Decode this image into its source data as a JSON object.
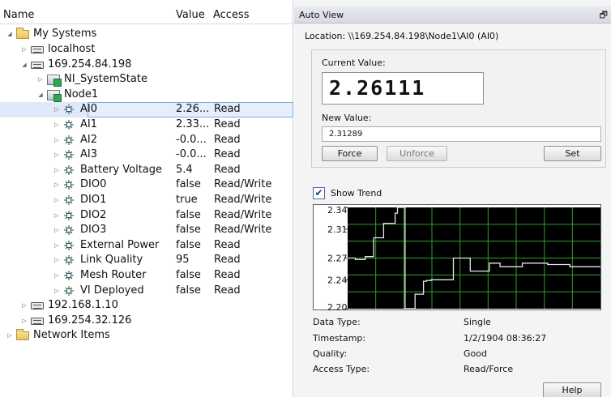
{
  "tree": {
    "columns": {
      "name": "Name",
      "value": "Value",
      "access": "Access"
    },
    "rows": [
      {
        "label": "My Systems",
        "icon": "folder-icon",
        "level": 0,
        "twisty": "open"
      },
      {
        "label": "localhost",
        "icon": "target-icon",
        "level": 1,
        "twisty": "closed"
      },
      {
        "label": "169.254.84.198",
        "icon": "target-icon",
        "level": 1,
        "twisty": "open"
      },
      {
        "label": "NI_SystemState",
        "icon": "node-icon",
        "level": 2,
        "twisty": "closed"
      },
      {
        "label": "Node1",
        "icon": "node-icon",
        "level": 2,
        "twisty": "open"
      },
      {
        "label": "AI0",
        "icon": "channel-icon",
        "level": 3,
        "twisty": "closed",
        "value": "2.26...",
        "access": "Read",
        "selected": true
      },
      {
        "label": "AI1",
        "icon": "channel-icon",
        "level": 3,
        "twisty": "closed",
        "value": "2.33...",
        "access": "Read"
      },
      {
        "label": "AI2",
        "icon": "channel-icon",
        "level": 3,
        "twisty": "closed",
        "value": "-0.0...",
        "access": "Read"
      },
      {
        "label": "AI3",
        "icon": "channel-icon",
        "level": 3,
        "twisty": "closed",
        "value": "-0.0...",
        "access": "Read"
      },
      {
        "label": "Battery Voltage",
        "icon": "channel-icon",
        "level": 3,
        "twisty": "closed",
        "value": "5.4",
        "access": "Read"
      },
      {
        "label": "DIO0",
        "icon": "channel-icon",
        "level": 3,
        "twisty": "closed",
        "value": "false",
        "access": "Read/Write"
      },
      {
        "label": "DIO1",
        "icon": "channel-icon",
        "level": 3,
        "twisty": "closed",
        "value": "true",
        "access": "Read/Write"
      },
      {
        "label": "DIO2",
        "icon": "channel-icon",
        "level": 3,
        "twisty": "closed",
        "value": "false",
        "access": "Read/Write"
      },
      {
        "label": "DIO3",
        "icon": "channel-icon",
        "level": 3,
        "twisty": "closed",
        "value": "false",
        "access": "Read/Write"
      },
      {
        "label": "External Power",
        "icon": "channel-icon",
        "level": 3,
        "twisty": "closed",
        "value": "false",
        "access": "Read"
      },
      {
        "label": "Link Quality",
        "icon": "channel-icon",
        "level": 3,
        "twisty": "closed",
        "value": "95",
        "access": "Read"
      },
      {
        "label": "Mesh Router",
        "icon": "channel-icon",
        "level": 3,
        "twisty": "closed",
        "value": "false",
        "access": "Read"
      },
      {
        "label": "VI Deployed",
        "icon": "channel-icon",
        "level": 3,
        "twisty": "closed",
        "value": "false",
        "access": "Read"
      },
      {
        "label": "192.168.1.10",
        "icon": "target-icon",
        "level": 1,
        "twisty": "closed"
      },
      {
        "label": "169.254.32.126",
        "icon": "target-icon",
        "level": 1,
        "twisty": "closed"
      },
      {
        "label": "Network Items",
        "icon": "folder-icon",
        "level": 0,
        "twisty": "closed"
      }
    ]
  },
  "panel": {
    "title": "Auto View",
    "restore_icon": "restore-window-icon",
    "location": "Location: \\\\169.254.84.198\\Node1\\AI0 (AI0)",
    "current_value_label": "Current Value:",
    "current_value": "2.26111",
    "new_value_label": "New Value:",
    "new_value": "2.31289",
    "force_label": "Force",
    "unforce_label": "Unforce",
    "set_label": "Set",
    "show_trend_label": "Show Trend",
    "show_trend_checked": true,
    "info": [
      {
        "label": "Data Type:",
        "value": "Single"
      },
      {
        "label": "Timestamp:",
        "value": "1/2/1904 08:36:27"
      },
      {
        "label": "Quality:",
        "value": "Good"
      },
      {
        "label": "Access Type:",
        "value": "Read/Force"
      }
    ],
    "help_label": "Help"
  },
  "chart_data": {
    "type": "line",
    "y_ticks": [
      "2.34",
      "2.31",
      "2.27",
      "2.24",
      "2.20"
    ],
    "ylim": [
      2.2,
      2.34
    ],
    "grid": true,
    "colors": {
      "background": "#000000",
      "grid": "#2f9e2f",
      "line": "#e6e6e6",
      "tick_label": "#111111"
    },
    "x": [
      0,
      10,
      10,
      23,
      23,
      34,
      34,
      47,
      47,
      62,
      62,
      65,
      65,
      75,
      75,
      88,
      88,
      99,
      99,
      103,
      103,
      109,
      109,
      138,
      138,
      160,
      160,
      185,
      185,
      199,
      199,
      228,
      228,
      261,
      261,
      290,
      290,
      330
    ],
    "values": [
      2.27,
      2.27,
      2.268,
      2.268,
      2.272,
      2.272,
      2.298,
      2.298,
      2.318,
      2.318,
      2.332,
      2.332,
      2.34,
      2.34,
      2.2,
      2.2,
      2.22,
      2.22,
      2.238,
      2.238,
      2.239,
      2.239,
      2.24,
      2.24,
      2.27,
      2.27,
      2.252,
      2.252,
      2.263,
      2.263,
      2.258,
      2.258,
      2.263,
      2.263,
      2.261,
      2.261,
      2.258,
      2.258
    ]
  }
}
